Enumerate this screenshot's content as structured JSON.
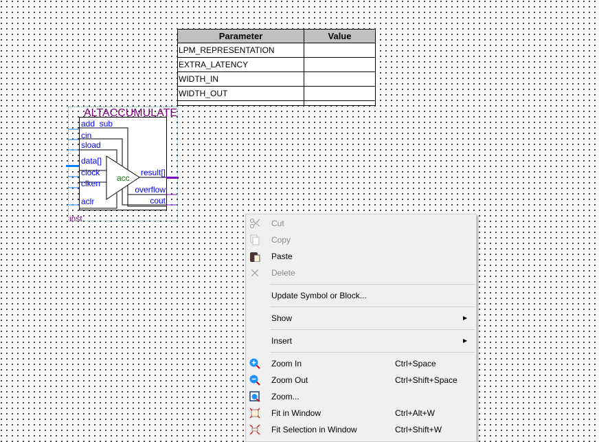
{
  "param_table": {
    "headers": [
      "Parameter",
      "Value"
    ],
    "rows": [
      {
        "name": "LPM_REPRESENTATION",
        "value": ""
      },
      {
        "name": "EXTRA_LATENCY",
        "value": ""
      },
      {
        "name": "WIDTH_IN",
        "value": ""
      },
      {
        "name": "WIDTH_OUT",
        "value": ""
      }
    ]
  },
  "symbol": {
    "title": "ALTACCUMULATE",
    "instance": "inst",
    "core": "acc",
    "inputs": [
      "add_sub",
      "cin",
      "sload",
      "data[]",
      "clock",
      "clken",
      "aclr"
    ],
    "outputs": [
      "result[]",
      "overflow",
      "cout"
    ]
  },
  "context_menu": {
    "items": [
      {
        "label": "Cut",
        "icon": "scissors-icon",
        "disabled": true
      },
      {
        "label": "Copy",
        "icon": "copy-icon",
        "disabled": true
      },
      {
        "label": "Paste",
        "icon": "paste-icon",
        "disabled": false
      },
      {
        "label": "Delete",
        "icon": "delete-x-icon",
        "disabled": true
      },
      {
        "label": "Update Symbol or Block..."
      },
      {
        "label": "Show",
        "submenu": true
      },
      {
        "label": "Insert",
        "submenu": true
      },
      {
        "label": "Zoom In",
        "shortcut": "Ctrl+Space",
        "icon": "zoom-in-icon"
      },
      {
        "label": "Zoom Out",
        "shortcut": "Ctrl+Shift+Space",
        "icon": "zoom-out-icon"
      },
      {
        "label": "Zoom...",
        "icon": "zoom-icon"
      },
      {
        "label": "Fit in Window",
        "shortcut": "Ctrl+Alt+W",
        "icon": "fit-window-icon"
      },
      {
        "label": "Fit Selection in Window",
        "shortcut": "Ctrl+Shift+W",
        "icon": "fit-selection-icon"
      }
    ],
    "submenu_arrow": "▶"
  },
  "colors": {
    "title": "#800080",
    "pin": "#0000ff",
    "wire": "#0080ff",
    "bus": "#8000c0",
    "core": "#008000"
  }
}
